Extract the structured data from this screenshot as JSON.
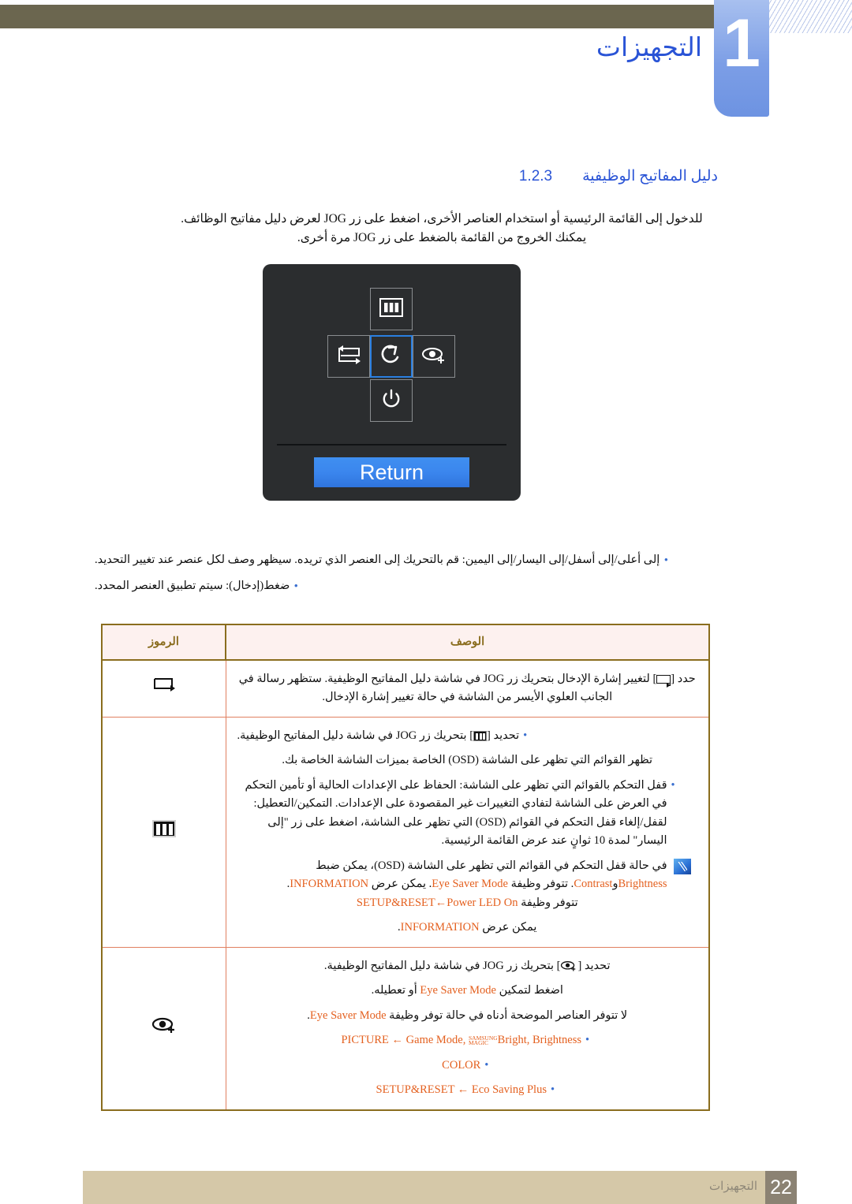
{
  "header": {
    "chapter_number": "1",
    "chapter_title": "التجهيزات"
  },
  "section": {
    "number": "1.2.3",
    "title": "دليل المفاتيح الوظيفية"
  },
  "intro": {
    "line1": "للدخول إلى القائمة الرئيسية أو استخدام العناصر الأخرى، اضغط على زر JOG لعرض دليل مفاتيح الوظائف.",
    "line2": "يمكنك الخروج من القائمة بالضغط على زر JOG مرة أخرى."
  },
  "osd": {
    "return_label": "Return",
    "keys": [
      {
        "name": "menu-key",
        "icon": "menu-icon"
      },
      {
        "name": "left-key",
        "icon": "input-source-icon"
      },
      {
        "name": "center-key",
        "icon": "return-arrow-icon",
        "selected": true
      },
      {
        "name": "right-key",
        "icon": "eye-saver-icon"
      },
      {
        "name": "power-key",
        "icon": "power-icon"
      }
    ]
  },
  "bullets": [
    {
      "dot": "•",
      "text": "إلى أعلى/إلى أسفل/إلى اليسار/إلى اليمين: قم بالتحريك إلى العنصر الذي تريده. سيظهر وصف لكل عنصر عند تغيير التحديد."
    },
    {
      "dot": "•",
      "text": "ضغط(إدخال): سيتم تطبيق العنصر المحدد."
    }
  ],
  "table": {
    "headers": {
      "description": "الوصف",
      "symbols": "الرموز"
    },
    "rows": [
      {
        "symbol": "input-source-icon",
        "lines": [
          {
            "type": "para",
            "pre": "حدد [",
            "sym": "input-source-icon",
            "post": "] لتغيير إشارة الإدخال بتحريك زر JOG في شاشة دليل المفاتيح الوظيفية. ستظهر رسالة في الجانب العلوي الأيسر من الشاشة في حالة تغيير إشارة الإدخال."
          }
        ]
      },
      {
        "symbol": "menu-icon",
        "lines": [
          {
            "type": "bullet",
            "pre": "تحديد [",
            "sym": "menu-icon",
            "post": "] بتحريك زر JOG في شاشة دليل المفاتيح الوظيفية."
          },
          {
            "type": "para",
            "text": "تظهر القوائم التي تظهر على الشاشة (OSD) الخاصة بميزات الشاشة الخاصة بك."
          },
          {
            "type": "bullet",
            "text": "قفل التحكم بالقوائم التي تظهر على الشاشة: الحفاظ على الإعدادات الحالية أو تأمين التحكم في العرض على الشاشة لتفادي التغييرات غير المقصودة على الإعدادات. التمكين/التعطيل: لقفل/إلغاء قفل التحكم في القوائم (OSD) التي تظهر على الشاشة، اضغط على زر \"إلى اليسار\" لمدة 10 ثوانٍ عند عرض القائمة الرئيسية."
          },
          {
            "type": "note",
            "text": "في حالة قفل التحكم في القوائم التي تظهر على الشاشة (OSD)، يمكن ضبط ",
            "o1": "Brightness",
            "mid1": "و",
            "o2": "Contrast",
            "tail1": ". تتوفر وظيفة ",
            "o3": "Eye Saver Mode",
            "tail2": ". يمكن عرض ",
            "o4": "INFORMATION",
            "tail3": "."
          },
          {
            "type": "para2",
            "head": "تتوفر وظيفة ",
            "o1": "SETUP&RESET",
            "arrow": "←",
            "o2": "Power LED On",
            "tail": ""
          },
          {
            "type": "para3",
            "head": "يمكن عرض ",
            "o1": "INFORMATION",
            "tail": "."
          }
        ]
      },
      {
        "symbol": "eye-saver-icon",
        "lines": [
          {
            "type": "para",
            "pre": "تحديد [",
            "sym": "eye-saver-icon",
            "post": "] بتحريك زر JOG في شاشة دليل المفاتيح الوظيفية."
          },
          {
            "type": "para",
            "pre2": "اضغط لتمكين ",
            "o": "Eye Saver Mode",
            "post2": " أو تعطيله."
          },
          {
            "type": "para",
            "pre3": "لا تتوفر العناصر الموضحة أدناه في حالة توفر وظيفة ",
            "o": "Eye Saver Mode",
            "post3": "."
          },
          {
            "type": "menu-bullet",
            "menu": "PICTURE",
            "arrow": "←",
            "items": "Game Mode, SAMSUNG MAGIC Bright, Brightness",
            "item1": "Game Mode",
            "magic_sup": "SAMSUNG",
            "magic_sub": "MAGIC",
            "magic_word": "Bright",
            "item3": "Brightness"
          },
          {
            "type": "menu-bullet-simple",
            "menu": "COLOR"
          },
          {
            "type": "menu-bullet2",
            "menu": "SETUP&RESET",
            "arrow": "←",
            "item": "Eco Saving Plus"
          }
        ]
      }
    ]
  },
  "footer": {
    "page_number": "22",
    "label": "التجهيزات"
  },
  "colors": {
    "accent_blue": "#2a54d6",
    "orange": "#e4601f",
    "table_border": "#8a6d1e",
    "table_inner": "#e08060",
    "header_bg": "#fdf1ef",
    "olive": "#6b664f",
    "footer_tan": "#d5c8a8"
  }
}
